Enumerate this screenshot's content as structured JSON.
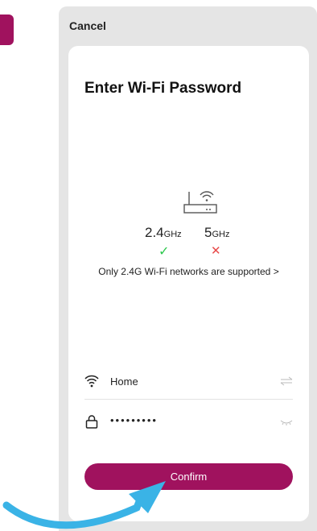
{
  "header": {
    "cancel_label": "Cancel"
  },
  "card": {
    "title": "Enter Wi-Fi Password",
    "bands": [
      {
        "value": "2.4",
        "unit": "GHz",
        "supported": true
      },
      {
        "value": "5",
        "unit": "GHz",
        "supported": false
      }
    ],
    "note": "Only 2.4G Wi-Fi networks are supported >"
  },
  "form": {
    "network_name": "Home",
    "password_mask": "•••••••••",
    "confirm_label": "Confirm"
  },
  "colors": {
    "brand": "#a0125e",
    "arrow": "#3ab3e6",
    "check": "#2cc84d",
    "cross": "#e84a4a"
  },
  "icons": [
    "router-icon",
    "wifi-icon",
    "lock-icon",
    "swap-icon",
    "eye-closed-icon",
    "check-icon",
    "cross-icon",
    "arrow-annotation"
  ]
}
